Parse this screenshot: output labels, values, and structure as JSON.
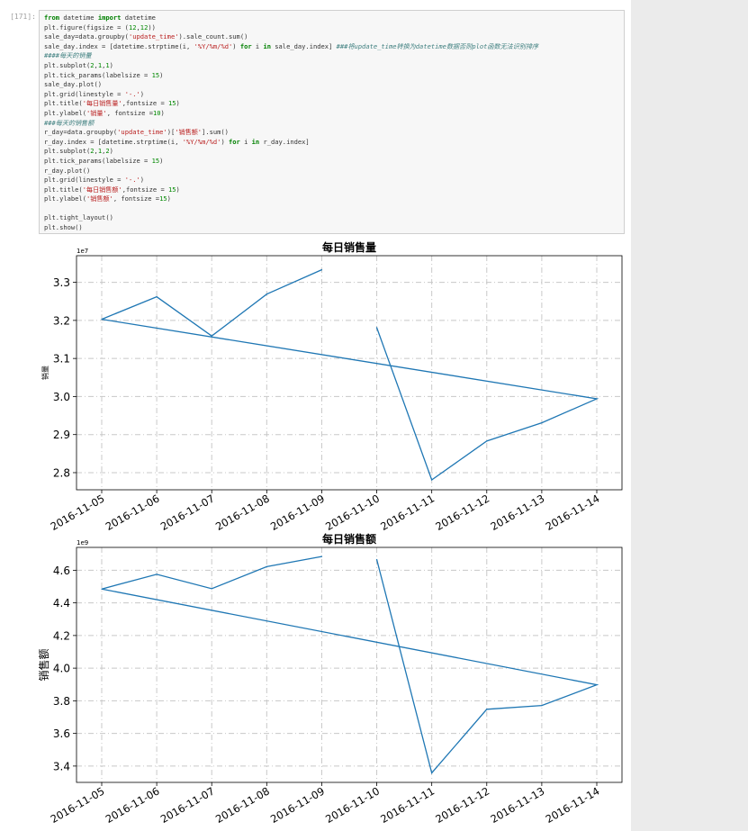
{
  "prompt_label": "[171]:",
  "code_lines": [
    [
      [
        "kw",
        "from"
      ],
      [
        "t",
        " datetime "
      ],
      [
        "kw",
        "import"
      ],
      [
        "t",
        " datetime"
      ]
    ],
    [
      [
        "t",
        "plt.figure(figsize = ("
      ],
      [
        "num",
        "12"
      ],
      [
        "t",
        ","
      ],
      [
        "num",
        "12"
      ],
      [
        "t",
        "))"
      ]
    ],
    [
      [
        "t",
        "sale_day=data.groupby("
      ],
      [
        "str",
        "'update_time'"
      ],
      [
        "t",
        ").sale_count.sum()"
      ]
    ],
    [
      [
        "t",
        "sale_day.index = [datetime.strptime(i, "
      ],
      [
        "str",
        "'%Y/%m/%d'"
      ],
      [
        "t",
        ") "
      ],
      [
        "kw",
        "for"
      ],
      [
        "t",
        " i "
      ],
      [
        "kw",
        "in"
      ],
      [
        "t",
        " sale_day.index] "
      ],
      [
        "cmt",
        "###将update_time转换为datetime数据否则plot函数无法识别排序"
      ]
    ],
    [
      [
        "cmt",
        "####每天的销量"
      ]
    ],
    [
      [
        "t",
        "plt.subplot("
      ],
      [
        "num",
        "2"
      ],
      [
        "t",
        ","
      ],
      [
        "num",
        "1"
      ],
      [
        "t",
        ","
      ],
      [
        "num",
        "1"
      ],
      [
        "t",
        ")"
      ]
    ],
    [
      [
        "t",
        "plt.tick_params(labelsize = "
      ],
      [
        "num",
        "15"
      ],
      [
        "t",
        ")"
      ]
    ],
    [
      [
        "t",
        "sale_day.plot()"
      ]
    ],
    [
      [
        "t",
        "plt.grid(linestyle = "
      ],
      [
        "str",
        "'-.'"
      ],
      [
        "t",
        ")"
      ]
    ],
    [
      [
        "t",
        "plt.title("
      ],
      [
        "str",
        "'每日销售量'"
      ],
      [
        "t",
        ",fontsize = "
      ],
      [
        "num",
        "15"
      ],
      [
        "t",
        ")"
      ]
    ],
    [
      [
        "t",
        "plt.ylabel("
      ],
      [
        "str",
        "'销量'"
      ],
      [
        "t",
        ", fontsize ="
      ],
      [
        "num",
        "10"
      ],
      [
        "t",
        ")"
      ]
    ],
    [
      [
        "cmt",
        "###每天的销售额"
      ]
    ],
    [
      [
        "t",
        "r_day=data.groupby("
      ],
      [
        "str",
        "'update_time'"
      ],
      [
        "t",
        ")["
      ],
      [
        "str",
        "'销售额'"
      ],
      [
        "t",
        "].sum()"
      ]
    ],
    [
      [
        "t",
        "r_day.index = [datetime.strptime(i, "
      ],
      [
        "str",
        "'%Y/%m/%d'"
      ],
      [
        "t",
        ") "
      ],
      [
        "kw",
        "for"
      ],
      [
        "t",
        " i "
      ],
      [
        "kw",
        "in"
      ],
      [
        "t",
        " r_day.index]"
      ]
    ],
    [
      [
        "t",
        "plt.subplot("
      ],
      [
        "num",
        "2"
      ],
      [
        "t",
        ","
      ],
      [
        "num",
        "1"
      ],
      [
        "t",
        ","
      ],
      [
        "num",
        "2"
      ],
      [
        "t",
        ")"
      ]
    ],
    [
      [
        "t",
        "plt.tick_params(labelsize = "
      ],
      [
        "num",
        "15"
      ],
      [
        "t",
        ")"
      ]
    ],
    [
      [
        "t",
        "r_day.plot()"
      ]
    ],
    [
      [
        "t",
        "plt.grid(linestyle = "
      ],
      [
        "str",
        "'-.'"
      ],
      [
        "t",
        ")"
      ]
    ],
    [
      [
        "t",
        "plt.title("
      ],
      [
        "str",
        "'每日销售额'"
      ],
      [
        "t",
        ",fontsize = "
      ],
      [
        "num",
        "15"
      ],
      [
        "t",
        ")"
      ]
    ],
    [
      [
        "t",
        "plt.ylabel("
      ],
      [
        "str",
        "'销售额'"
      ],
      [
        "t",
        ", fontsize ="
      ],
      [
        "num",
        "15"
      ],
      [
        "t",
        ")"
      ]
    ],
    [
      [
        "t",
        ""
      ]
    ],
    [
      [
        "t",
        "plt.tight_layout()"
      ]
    ],
    [
      [
        "t",
        "plt.show()"
      ]
    ]
  ],
  "chart_data": [
    {
      "type": "line",
      "title": "每日销售量",
      "ylabel": "销量",
      "offset_label": "1e7",
      "categories": [
        "2016-11-05",
        "2016-11-06",
        "2016-11-07",
        "2016-11-08",
        "2016-11-09",
        "2016-11-10",
        "2016-11-11",
        "2016-11-12",
        "2016-11-13",
        "2016-11-14"
      ],
      "point_order": [
        0,
        1,
        2,
        3,
        4,
        null,
        5,
        6,
        7,
        8,
        9,
        0
      ],
      "values": [
        3.203,
        3.262,
        3.159,
        3.269,
        3.333,
        3.181,
        2.781,
        2.883,
        2.931,
        2.994
      ],
      "x_note": "series index order: 11-05,11-06,11-07,11-08,11-09,11-10,11-11,11-12,11-13,11-14 (unsorted with 11-14 before 11-05 wrap)",
      "ylim": [
        2.755,
        3.37
      ],
      "yticks": [
        "2.8",
        "2.9",
        "3.0",
        "3.1",
        "3.2",
        "3.3"
      ],
      "ytick_values": [
        2.8,
        2.9,
        3.0,
        3.1,
        3.2,
        3.3
      ],
      "grid": true,
      "line_color": "#1f77b4"
    },
    {
      "type": "line",
      "title": "每日销售额",
      "ylabel": "销售额",
      "offset_label": "1e9",
      "categories": [
        "2016-11-05",
        "2016-11-06",
        "2016-11-07",
        "2016-11-08",
        "2016-11-09",
        "2016-11-10",
        "2016-11-11",
        "2016-11-12",
        "2016-11-13",
        "2016-11-14"
      ],
      "values": [
        4.485,
        4.575,
        4.487,
        4.622,
        4.684,
        4.666,
        3.358,
        3.748,
        3.771,
        3.898
      ],
      "ylim": [
        3.3,
        4.74
      ],
      "yticks": [
        "3.4",
        "3.6",
        "3.8",
        "4.0",
        "4.2",
        "4.4",
        "4.6"
      ],
      "ytick_values": [
        3.4,
        3.6,
        3.8,
        4.0,
        4.2,
        4.4,
        4.6
      ],
      "grid": true,
      "line_color": "#1f77b4"
    }
  ]
}
